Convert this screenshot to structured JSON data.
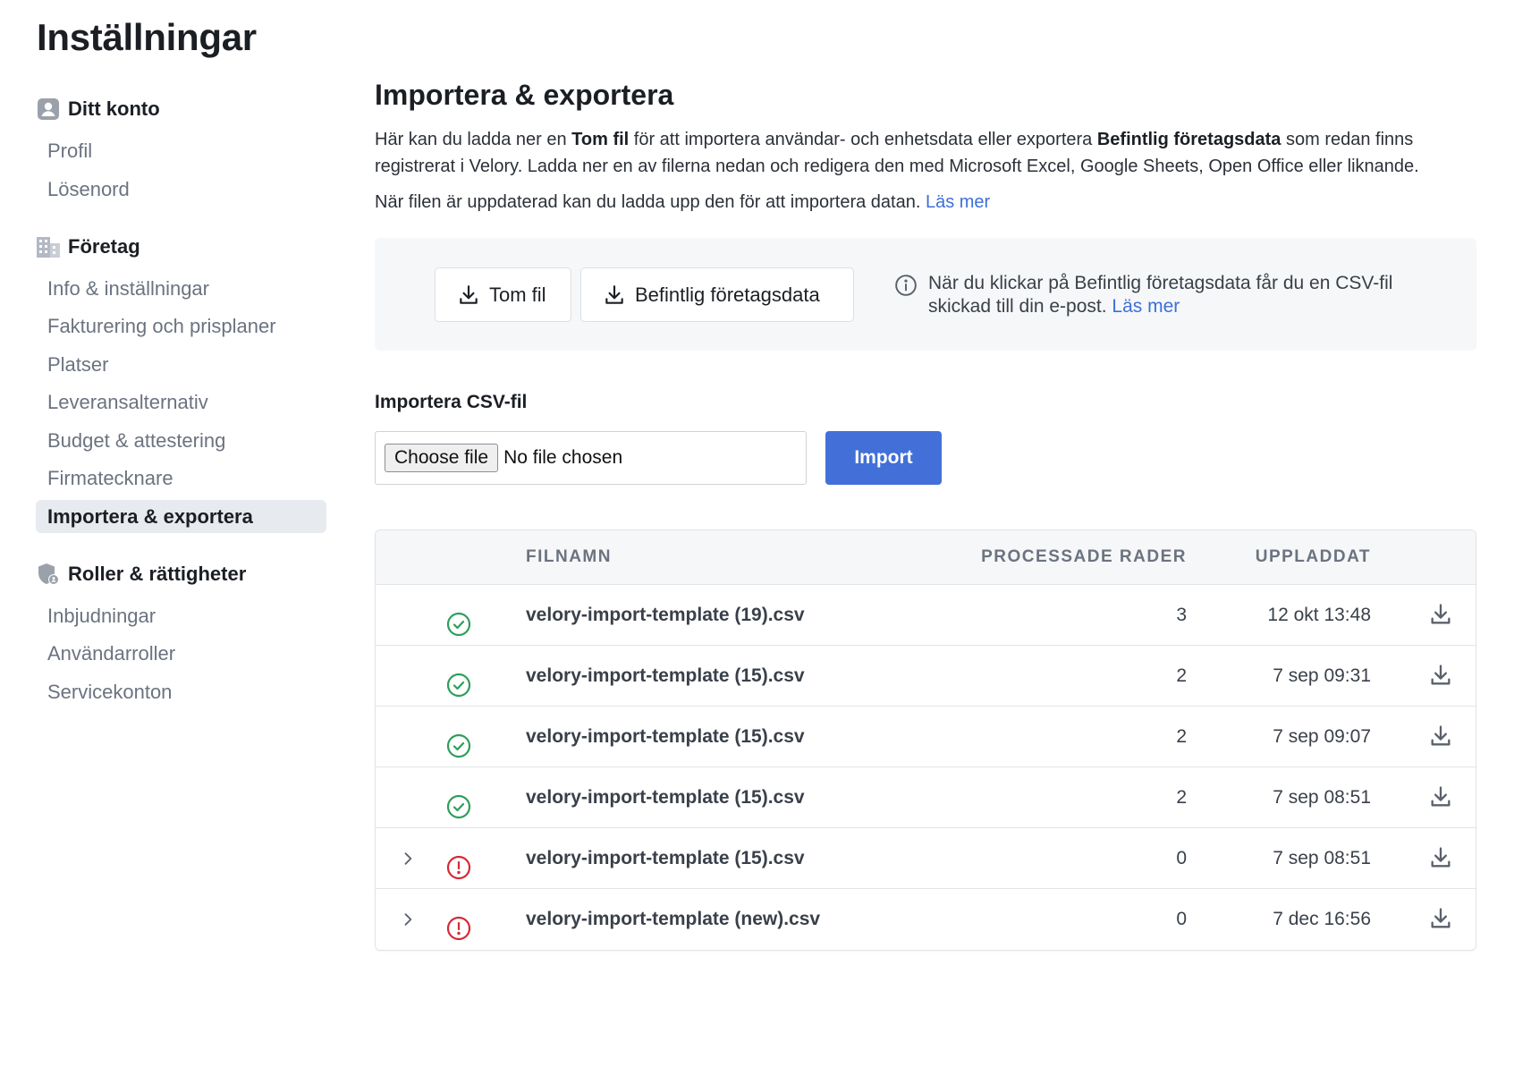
{
  "page": {
    "title": "Inställningar"
  },
  "sidebar": {
    "groups": [
      {
        "label": "Ditt konto",
        "icon": "user-icon",
        "items": [
          "Profil",
          "Lösenord"
        ]
      },
      {
        "label": "Företag",
        "icon": "building-icon",
        "items": [
          "Info & inställningar",
          "Fakturering och prisplaner",
          "Platser",
          "Leveransalternativ",
          "Budget & attestering",
          "Firmatecknare",
          "Importera & exportera"
        ]
      },
      {
        "label": "Roller & rättigheter",
        "icon": "shield-user-icon",
        "items": [
          "Inbjudningar",
          "Användarroller",
          "Servicekonton"
        ]
      }
    ],
    "active_item": "Importera & exportera"
  },
  "main": {
    "title": "Importera & exportera",
    "desc": {
      "p1_a": "Här kan du ladda ner en ",
      "p1_b": "Tom fil",
      "p1_c": " för att importera användar- och enhetsdata eller exportera ",
      "p1_d": "Befintlig företagsdata",
      "p1_e": " som redan finns registrerat i Velory. Ladda ner en av filerna nedan och redigera den med Microsoft Excel, Google Sheets, Open Office eller liknande.",
      "p2": "När filen är uppdaterad kan du ladda upp den för att importera datan. ",
      "p2_link": "Läs mer"
    },
    "export": {
      "empty_file_label": "Tom fil",
      "existing_data_label": "Befintlig företagsdata",
      "info_text": "När du klickar på Befintlig företagsdata får du en CSV-fil skickad till din e-post. ",
      "info_link": "Läs mer"
    },
    "import": {
      "label": "Importera CSV-fil",
      "choose_file": "Choose file",
      "no_file": "No file chosen",
      "button": "Import"
    },
    "table": {
      "headers": {
        "name": "FILNAMN",
        "rows": "PROCESSADE RADER",
        "date": "UPPLADDAT"
      },
      "rows": [
        {
          "status": "success",
          "expandable": false,
          "name": "velory-import-template (19).csv",
          "rows": "3",
          "date": "12 okt 13:48"
        },
        {
          "status": "success",
          "expandable": false,
          "name": "velory-import-template (15).csv",
          "rows": "2",
          "date": "7 sep 09:31"
        },
        {
          "status": "success",
          "expandable": false,
          "name": "velory-import-template (15).csv",
          "rows": "2",
          "date": "7 sep 09:07"
        },
        {
          "status": "success",
          "expandable": false,
          "name": "velory-import-template (15).csv",
          "rows": "2",
          "date": "7 sep 08:51"
        },
        {
          "status": "error",
          "expandable": true,
          "name": "velory-import-template (15).csv",
          "rows": "0",
          "date": "7 sep 08:51"
        },
        {
          "status": "error",
          "expandable": true,
          "name": "velory-import-template (new).csv",
          "rows": "0",
          "date": "7 dec 16:56"
        }
      ]
    }
  },
  "colors": {
    "accent": "#4270d8",
    "link": "#3d6fd9",
    "success": "#2e9e5b",
    "error": "#d42a36",
    "active_bg": "#e7eaee"
  }
}
